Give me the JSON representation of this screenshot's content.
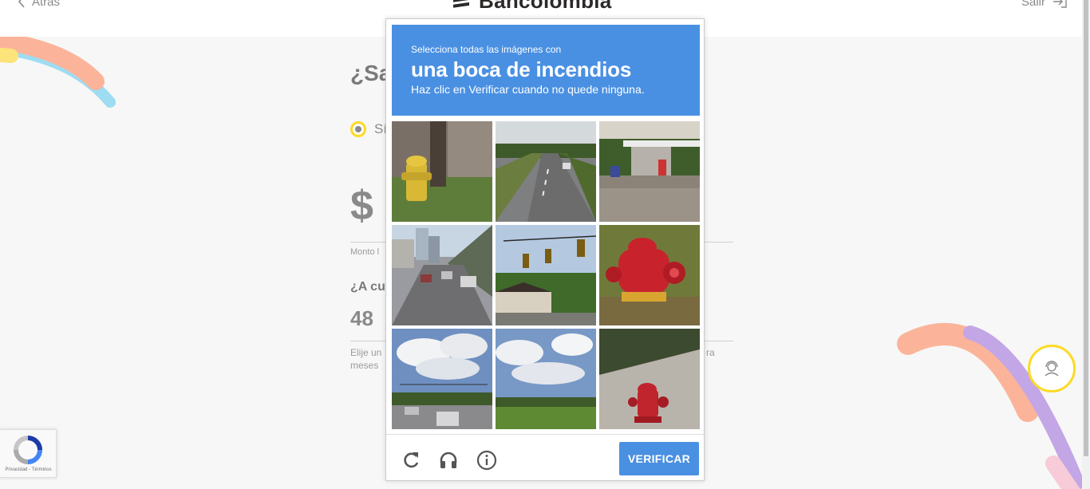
{
  "header": {
    "back_label": "Atrás",
    "brand_name": "Bancolombia",
    "exit_label": "Salir"
  },
  "form": {
    "question_title": "¿Sa",
    "radio_label": "Sí",
    "amount_text": "$ 1",
    "amount_label": "Monto l",
    "question_months": "¿A cuá",
    "months_value": "48",
    "hint_line1": "Elije un",
    "hint_line1_right": "ra",
    "hint_line2": "meses"
  },
  "recaptcha_badge": {
    "text": "Privacidad - Términos"
  },
  "captcha": {
    "prompt_line1": "Selecciona todas las imágenes con",
    "prompt_keyword": "una boca de incendios",
    "prompt_line2": "Haz clic en Verificar cuando no quede ninguna.",
    "verify_label": "VERIFICAR",
    "tiles": [
      {
        "icon": "yellow-hydrant-photo"
      },
      {
        "icon": "highway-photo"
      },
      {
        "icon": "gas-station-photo"
      },
      {
        "icon": "city-traffic-photo"
      },
      {
        "icon": "traffic-lights-photo"
      },
      {
        "icon": "red-hydrant-closeup-photo"
      },
      {
        "icon": "street-clouds-photo"
      },
      {
        "icon": "field-clouds-photo"
      },
      {
        "icon": "red-hydrant-sidewalk-photo"
      }
    ]
  },
  "colors": {
    "prompt_blue": "#4a90e2",
    "brand_yellow": "#fdda24",
    "deco_salmon": "#fbb49a",
    "deco_lavender": "#c3a6e6",
    "deco_skyblue": "#9edcf2"
  }
}
